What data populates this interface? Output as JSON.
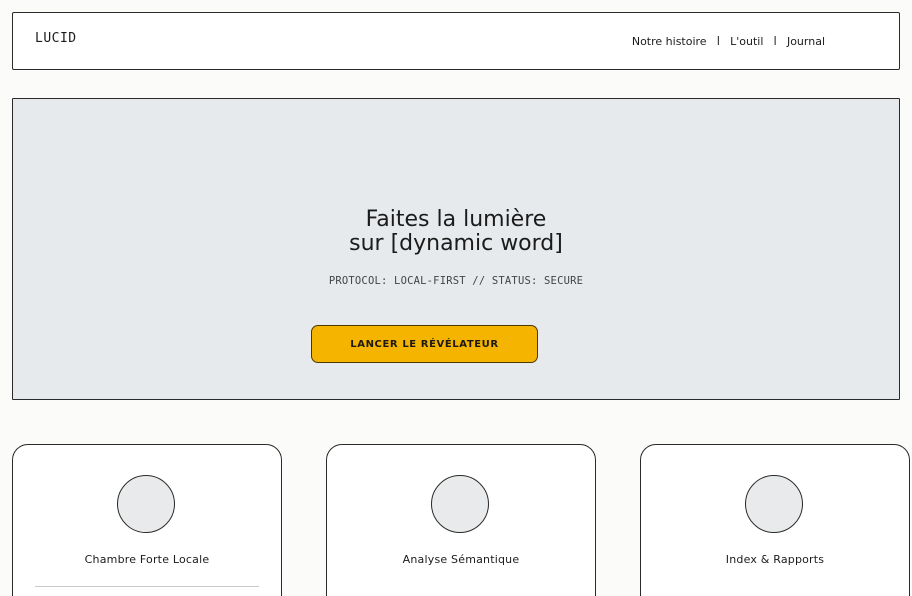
{
  "header": {
    "logo": "LUCID",
    "nav": [
      {
        "label": "Notre histoire"
      },
      {
        "label": "L'outil"
      },
      {
        "label": "Journal"
      }
    ],
    "separator": "I"
  },
  "hero": {
    "title_line1": "Faites la lumière",
    "title_line2": "sur [dynamic word]",
    "status": "PROTOCOL: LOCAL-FIRST // STATUS: SECURE",
    "cta_label": "LANCER LE RÉVÉLATEUR"
  },
  "cards": [
    {
      "title": "Chambre Forte Locale"
    },
    {
      "title": "Analyse Sémantique"
    },
    {
      "title": "Index & Rapports"
    }
  ],
  "colors": {
    "cta": "#f4b400",
    "hero_background": "#e7eaec"
  }
}
